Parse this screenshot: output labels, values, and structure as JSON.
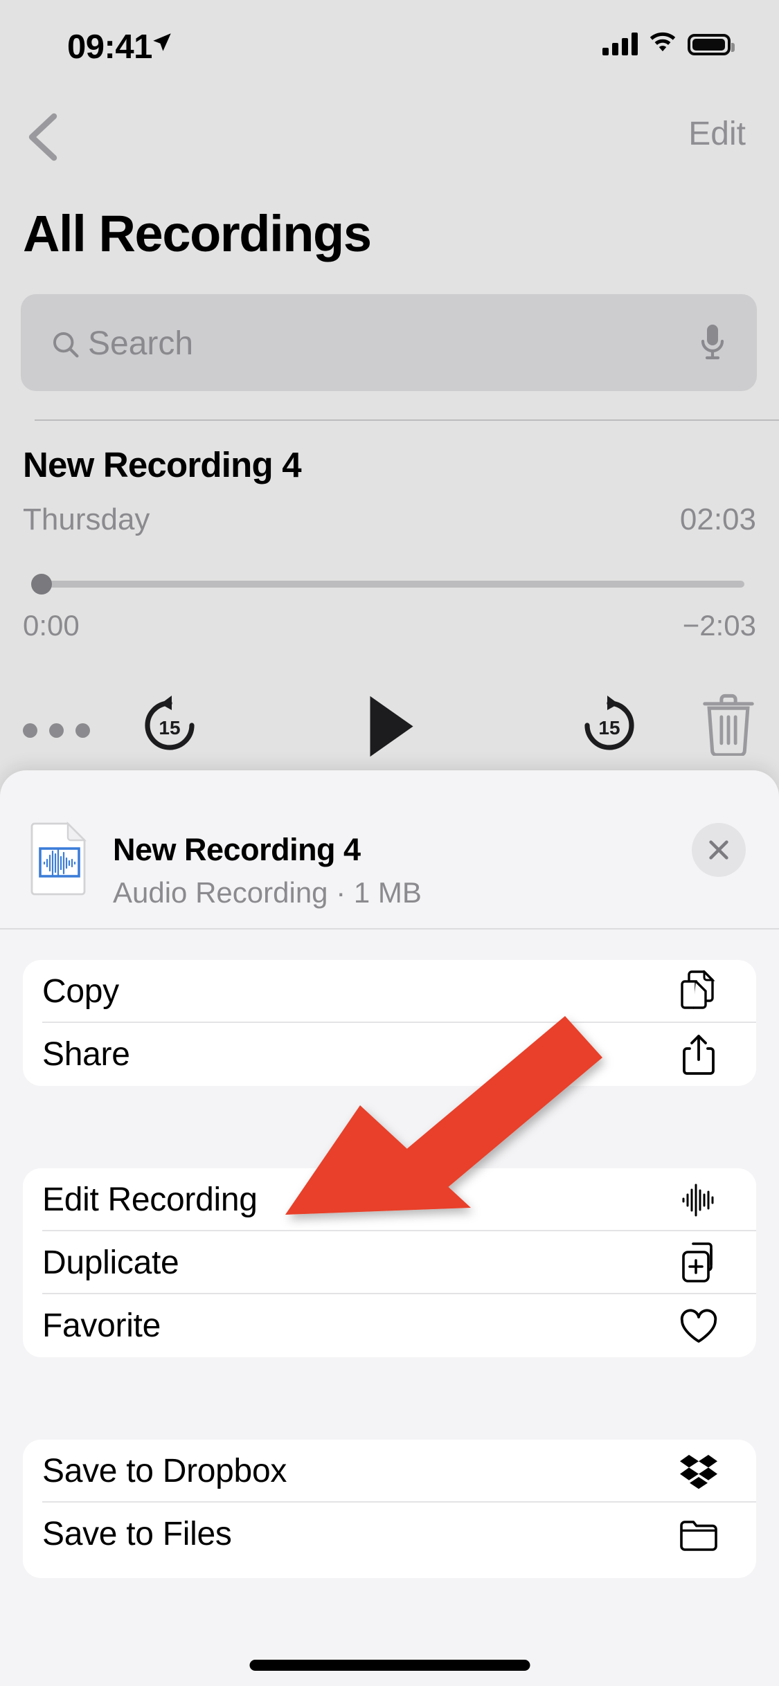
{
  "status_bar": {
    "time": "09:41",
    "location_icon": "location-arrow-icon",
    "cellular_icon": "cellular-bars-icon",
    "wifi_icon": "wifi-icon",
    "battery_icon": "battery-full-icon"
  },
  "nav": {
    "back_icon": "chevron-left-icon",
    "edit_label": "Edit"
  },
  "page_title": "All Recordings",
  "search": {
    "placeholder": "Search",
    "value": "",
    "search_icon": "magnifier-icon",
    "dictate_icon": "microphone-icon"
  },
  "recording": {
    "title": "New Recording 4",
    "date": "Thursday",
    "duration": "02:03",
    "elapsed": "0:00",
    "remaining": "−2:03",
    "progress_percent": 0
  },
  "transport": {
    "more_icon": "ellipsis-icon",
    "back_15_icon": "rewind-15-icon",
    "back_15_label": "15",
    "play_icon": "play-icon",
    "forward_15_icon": "forward-15-icon",
    "forward_15_label": "15",
    "delete_icon": "trash-icon"
  },
  "share_sheet": {
    "file_icon": "audio-document-icon",
    "file_title": "New Recording 4",
    "file_subtitle": "Audio Recording · 1 MB",
    "close_icon": "close-x-icon",
    "cards": [
      {
        "rows": [
          {
            "label": "Copy",
            "icon": "copy-documents-icon"
          },
          {
            "label": "Share",
            "icon": "share-up-arrow-icon"
          }
        ]
      },
      {
        "rows": [
          {
            "label": "Edit Recording",
            "icon": "waveform-icon"
          },
          {
            "label": "Duplicate",
            "icon": "duplicate-plus-icon"
          },
          {
            "label": "Favorite",
            "icon": "heart-icon"
          }
        ]
      },
      {
        "rows": [
          {
            "label": "Save to Dropbox",
            "icon": "dropbox-icon"
          },
          {
            "label": "Save to Files",
            "icon": "folder-icon"
          }
        ]
      }
    ]
  },
  "annotation": {
    "arrow_color": "#E8402A",
    "points_at": "Edit Recording"
  },
  "colors": {
    "background": "#e2e2e2",
    "sheet_background": "#f4f4f6",
    "card_background": "#ffffff",
    "secondary_text": "#8b8b8f",
    "accent_blue": "#3b7dd8"
  }
}
